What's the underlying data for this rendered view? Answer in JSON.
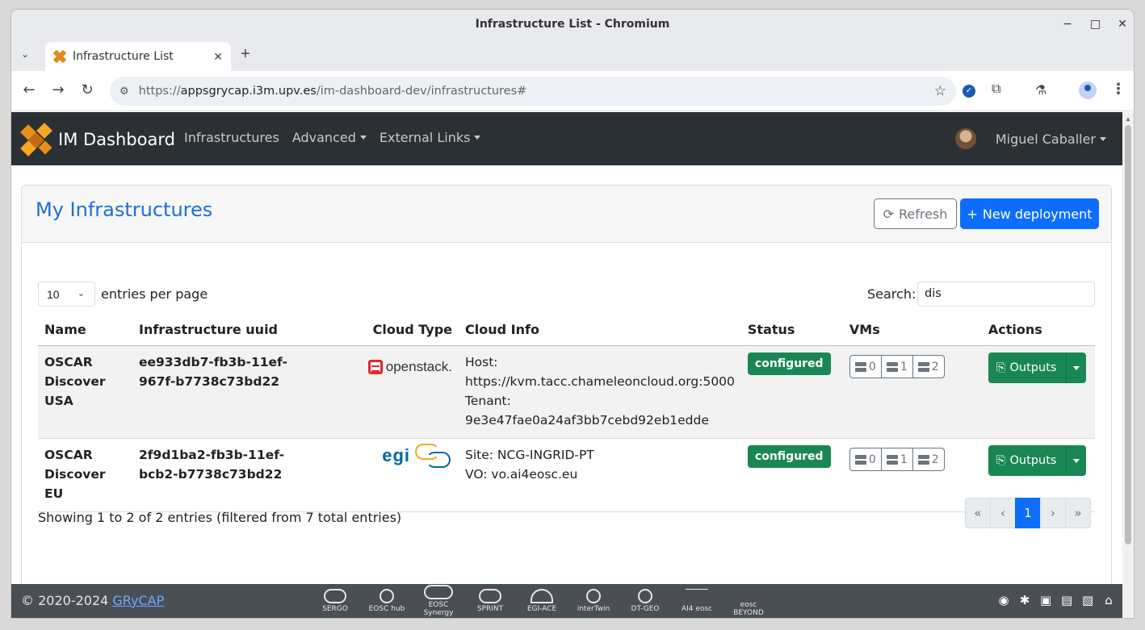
{
  "window": {
    "title": "Infrastructure List - Chromium"
  },
  "browser": {
    "tab_title": "Infrastructure List",
    "url_prefix": "https://",
    "url_host": "appsgrycap.i3m.upv.es",
    "url_path": "/im-dashboard-dev/infrastructures#"
  },
  "navbar": {
    "brand": "IM Dashboard",
    "links": [
      "Infrastructures",
      "Advanced",
      "External Links"
    ],
    "user": "Miguel Caballer"
  },
  "card": {
    "title": "My Infrastructures",
    "refresh_label": "Refresh",
    "new_label": "New deployment"
  },
  "controls": {
    "page_length": "10",
    "page_length_label": "entries per page",
    "search_label": "Search:",
    "search_value": "dis"
  },
  "table": {
    "headers": [
      "Name",
      "Infrastructure uuid",
      "Cloud Type",
      "Cloud Info",
      "Status",
      "VMs",
      "Actions"
    ],
    "rows": [
      {
        "name": "OSCAR Discover USA",
        "uuid": "ee933db7-fb3b-11ef-967f-b7738c73bd22",
        "cloud_logo": "openstack",
        "info_line1": "Host:",
        "info_line2": "https://kvm.tacc.chameleoncloud.org:5000",
        "info_line3": "Tenant:",
        "info_line4": "9e3e47fae0a24af3bb7cebd92eb1edde",
        "status": "configured",
        "vms": [
          "0",
          "1",
          "2"
        ],
        "action": "Outputs"
      },
      {
        "name": "OSCAR Discover EU",
        "uuid": "2f9d1ba2-fb3b-11ef-bcb2-b7738c73bd22",
        "cloud_logo": "egi",
        "info_line1": "Site: NCG-INGRID-PT",
        "info_line2": "VO: vo.ai4eosc.eu",
        "status": "configured",
        "vms": [
          "0",
          "1",
          "2"
        ],
        "action": "Outputs"
      }
    ]
  },
  "pagination": {
    "info": "Showing 1 to 2 of 2 entries (filtered from 7 total entries)",
    "first": "«",
    "prev": "‹",
    "current": "1",
    "next": "›",
    "last": "»"
  },
  "footer": {
    "copyright": "© 2020-2024 ",
    "link": "GRyCAP",
    "partners": [
      "SERGO",
      "EOSC hub",
      "EOSC Synergy",
      "SPRINT",
      "EGI-ACE",
      "interTwin",
      "DT-GEO",
      "AI4 eosc",
      "eosc BEYOND"
    ]
  },
  "colors": {
    "navbar": "#2b3035",
    "primary": "#0d6efd",
    "success": "#198754",
    "title": "#1e6fd9",
    "footer": "#4a4f55"
  }
}
